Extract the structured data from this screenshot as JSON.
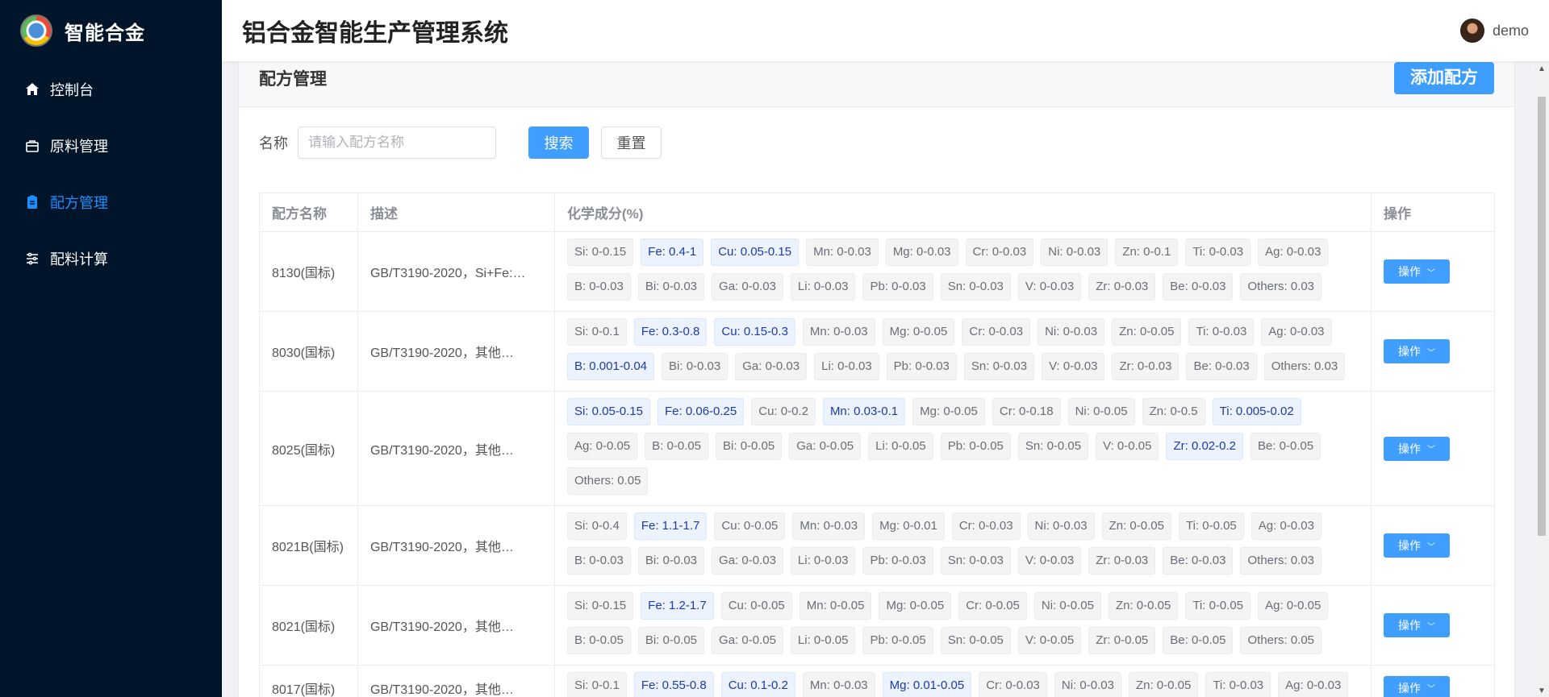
{
  "brand": {
    "name": "智能合金"
  },
  "header": {
    "title": "铝合金智能生产管理系统",
    "user": "demo"
  },
  "sidebar": {
    "items": [
      {
        "label": "控制台",
        "icon": "home-icon",
        "active": false
      },
      {
        "label": "原料管理",
        "icon": "box-icon",
        "active": false
      },
      {
        "label": "配方管理",
        "icon": "clipboard-icon",
        "active": true
      },
      {
        "label": "配料计算",
        "icon": "sliders-icon",
        "active": false
      }
    ]
  },
  "page": {
    "title": "配方管理",
    "add_label": "添加配方",
    "search": {
      "label": "名称",
      "placeholder": "请输入配方名称",
      "value": ""
    },
    "search_btn": "搜索",
    "reset_btn": "重置"
  },
  "table": {
    "columns": [
      "配方名称",
      "描述",
      "化学成分(%)",
      "操作"
    ],
    "op_label": "操作",
    "rows": [
      {
        "name": "8130(国标)",
        "desc": "GB/T3190-2020，Si+Fe:…",
        "chem": [
          {
            "t": "Si: 0-0.15"
          },
          {
            "t": "Fe: 0.4-1",
            "h": true
          },
          {
            "t": "Cu: 0.05-0.15",
            "h": true
          },
          {
            "t": "Mn: 0-0.03"
          },
          {
            "t": "Mg: 0-0.03"
          },
          {
            "t": "Cr: 0-0.03"
          },
          {
            "t": "Ni: 0-0.03"
          },
          {
            "t": "Zn: 0-0.1"
          },
          {
            "t": "Ti: 0-0.03"
          },
          {
            "t": "Ag: 0-0.03"
          },
          {
            "t": "B: 0-0.03"
          },
          {
            "t": "Bi: 0-0.03"
          },
          {
            "t": "Ga: 0-0.03"
          },
          {
            "t": "Li: 0-0.03"
          },
          {
            "t": "Pb: 0-0.03"
          },
          {
            "t": "Sn: 0-0.03"
          },
          {
            "t": "V: 0-0.03"
          },
          {
            "t": "Zr: 0-0.03"
          },
          {
            "t": "Be: 0-0.03"
          },
          {
            "t": "Others: 0.03"
          }
        ]
      },
      {
        "name": "8030(国标)",
        "desc": "GB/T3190-2020，其他…",
        "chem": [
          {
            "t": "Si: 0-0.1"
          },
          {
            "t": "Fe: 0.3-0.8",
            "h": true
          },
          {
            "t": "Cu: 0.15-0.3",
            "h": true
          },
          {
            "t": "Mn: 0-0.03"
          },
          {
            "t": "Mg: 0-0.05"
          },
          {
            "t": "Cr: 0-0.03"
          },
          {
            "t": "Ni: 0-0.03"
          },
          {
            "t": "Zn: 0-0.05"
          },
          {
            "t": "Ti: 0-0.03"
          },
          {
            "t": "Ag: 0-0.03"
          },
          {
            "t": "B: 0.001-0.04",
            "h": true
          },
          {
            "t": "Bi: 0-0.03"
          },
          {
            "t": "Ga: 0-0.03"
          },
          {
            "t": "Li: 0-0.03"
          },
          {
            "t": "Pb: 0-0.03"
          },
          {
            "t": "Sn: 0-0.03"
          },
          {
            "t": "V: 0-0.03"
          },
          {
            "t": "Zr: 0-0.03"
          },
          {
            "t": "Be: 0-0.03"
          },
          {
            "t": "Others: 0.03"
          }
        ]
      },
      {
        "name": "8025(国标)",
        "desc": "GB/T3190-2020，其他…",
        "chem": [
          {
            "t": "Si: 0.05-0.15",
            "h": true
          },
          {
            "t": "Fe: 0.06-0.25",
            "h": true
          },
          {
            "t": "Cu: 0-0.2"
          },
          {
            "t": "Mn: 0.03-0.1",
            "h": true
          },
          {
            "t": "Mg: 0-0.05"
          },
          {
            "t": "Cr: 0-0.18"
          },
          {
            "t": "Ni: 0-0.05"
          },
          {
            "t": "Zn: 0-0.5"
          },
          {
            "t": "Ti: 0.005-0.02",
            "h": true
          },
          {
            "t": "Ag: 0-0.05"
          },
          {
            "t": "B: 0-0.05"
          },
          {
            "t": "Bi: 0-0.05"
          },
          {
            "t": "Ga: 0-0.05"
          },
          {
            "t": "Li: 0-0.05"
          },
          {
            "t": "Pb: 0-0.05"
          },
          {
            "t": "Sn: 0-0.05"
          },
          {
            "t": "V: 0-0.05"
          },
          {
            "t": "Zr: 0.02-0.2",
            "h": true
          },
          {
            "t": "Be: 0-0.05"
          },
          {
            "t": "Others: 0.05"
          }
        ]
      },
      {
        "name": "8021B(国标)",
        "desc": "GB/T3190-2020，其他…",
        "chem": [
          {
            "t": "Si: 0-0.4"
          },
          {
            "t": "Fe: 1.1-1.7",
            "h": true
          },
          {
            "t": "Cu: 0-0.05"
          },
          {
            "t": "Mn: 0-0.03"
          },
          {
            "t": "Mg: 0-0.01"
          },
          {
            "t": "Cr: 0-0.03"
          },
          {
            "t": "Ni: 0-0.03"
          },
          {
            "t": "Zn: 0-0.05"
          },
          {
            "t": "Ti: 0-0.05"
          },
          {
            "t": "Ag: 0-0.03"
          },
          {
            "t": "B: 0-0.03"
          },
          {
            "t": "Bi: 0-0.03"
          },
          {
            "t": "Ga: 0-0.03"
          },
          {
            "t": "Li: 0-0.03"
          },
          {
            "t": "Pb: 0-0.03"
          },
          {
            "t": "Sn: 0-0.03"
          },
          {
            "t": "V: 0-0.03"
          },
          {
            "t": "Zr: 0-0.03"
          },
          {
            "t": "Be: 0-0.03"
          },
          {
            "t": "Others: 0.03"
          }
        ]
      },
      {
        "name": "8021(国标)",
        "desc": "GB/T3190-2020，其他…",
        "chem": [
          {
            "t": "Si: 0-0.15"
          },
          {
            "t": "Fe: 1.2-1.7",
            "h": true
          },
          {
            "t": "Cu: 0-0.05"
          },
          {
            "t": "Mn: 0-0.05"
          },
          {
            "t": "Mg: 0-0.05"
          },
          {
            "t": "Cr: 0-0.05"
          },
          {
            "t": "Ni: 0-0.05"
          },
          {
            "t": "Zn: 0-0.05"
          },
          {
            "t": "Ti: 0-0.05"
          },
          {
            "t": "Ag: 0-0.05"
          },
          {
            "t": "B: 0-0.05"
          },
          {
            "t": "Bi: 0-0.05"
          },
          {
            "t": "Ga: 0-0.05"
          },
          {
            "t": "Li: 0-0.05"
          },
          {
            "t": "Pb: 0-0.05"
          },
          {
            "t": "Sn: 0-0.05"
          },
          {
            "t": "V: 0-0.05"
          },
          {
            "t": "Zr: 0-0.05"
          },
          {
            "t": "Be: 0-0.05"
          },
          {
            "t": "Others: 0.05"
          }
        ]
      },
      {
        "name": "8017(国标)",
        "desc": "GB/T3190-2020，其他…",
        "chem": [
          {
            "t": "Si: 0-0.1"
          },
          {
            "t": "Fe: 0.55-0.8",
            "h": true
          },
          {
            "t": "Cu: 0.1-0.2",
            "h": true
          },
          {
            "t": "Mn: 0-0.03"
          },
          {
            "t": "Mg: 0.01-0.05",
            "h": true
          },
          {
            "t": "Cr: 0-0.03"
          },
          {
            "t": "Ni: 0-0.03"
          },
          {
            "t": "Zn: 0-0.05"
          },
          {
            "t": "Ti: 0-0.03"
          },
          {
            "t": "Ag: 0-0.03"
          }
        ]
      }
    ]
  }
}
